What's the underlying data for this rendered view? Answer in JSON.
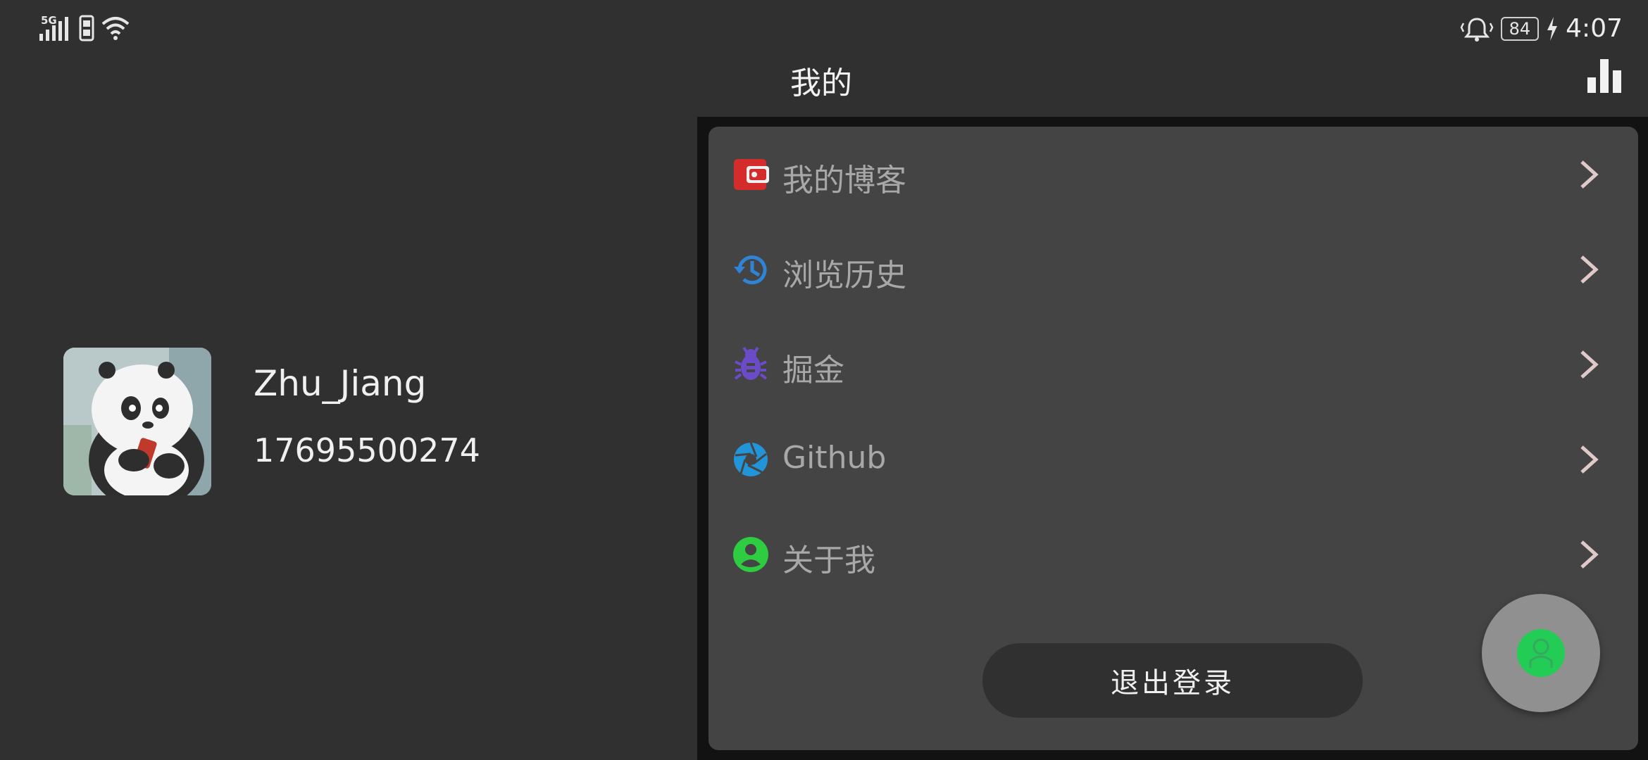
{
  "status_bar": {
    "network": "5G",
    "battery": "84",
    "time": "4:07"
  },
  "header": {
    "title": "我的",
    "chart_icon": "bar-chart-icon"
  },
  "profile": {
    "username": "Zhu_Jiang",
    "user_id": "17695500274",
    "avatar_icon": "panda-avatar"
  },
  "menu": {
    "items": [
      {
        "label": "我的博客",
        "icon": "wallet-icon",
        "color": "#d42b2b"
      },
      {
        "label": "浏览历史",
        "icon": "history-icon",
        "color": "#2f84d6"
      },
      {
        "label": "掘金",
        "icon": "bug-icon",
        "color": "#6b4bc7"
      },
      {
        "label": "Github",
        "icon": "aperture-icon",
        "color": "#2294d8"
      },
      {
        "label": "关于我",
        "icon": "account-circle-icon",
        "color": "#2ecc40"
      }
    ]
  },
  "logout": {
    "label": "退出登录"
  },
  "fab": {
    "icon": "person-icon",
    "color": "#22cc55"
  }
}
